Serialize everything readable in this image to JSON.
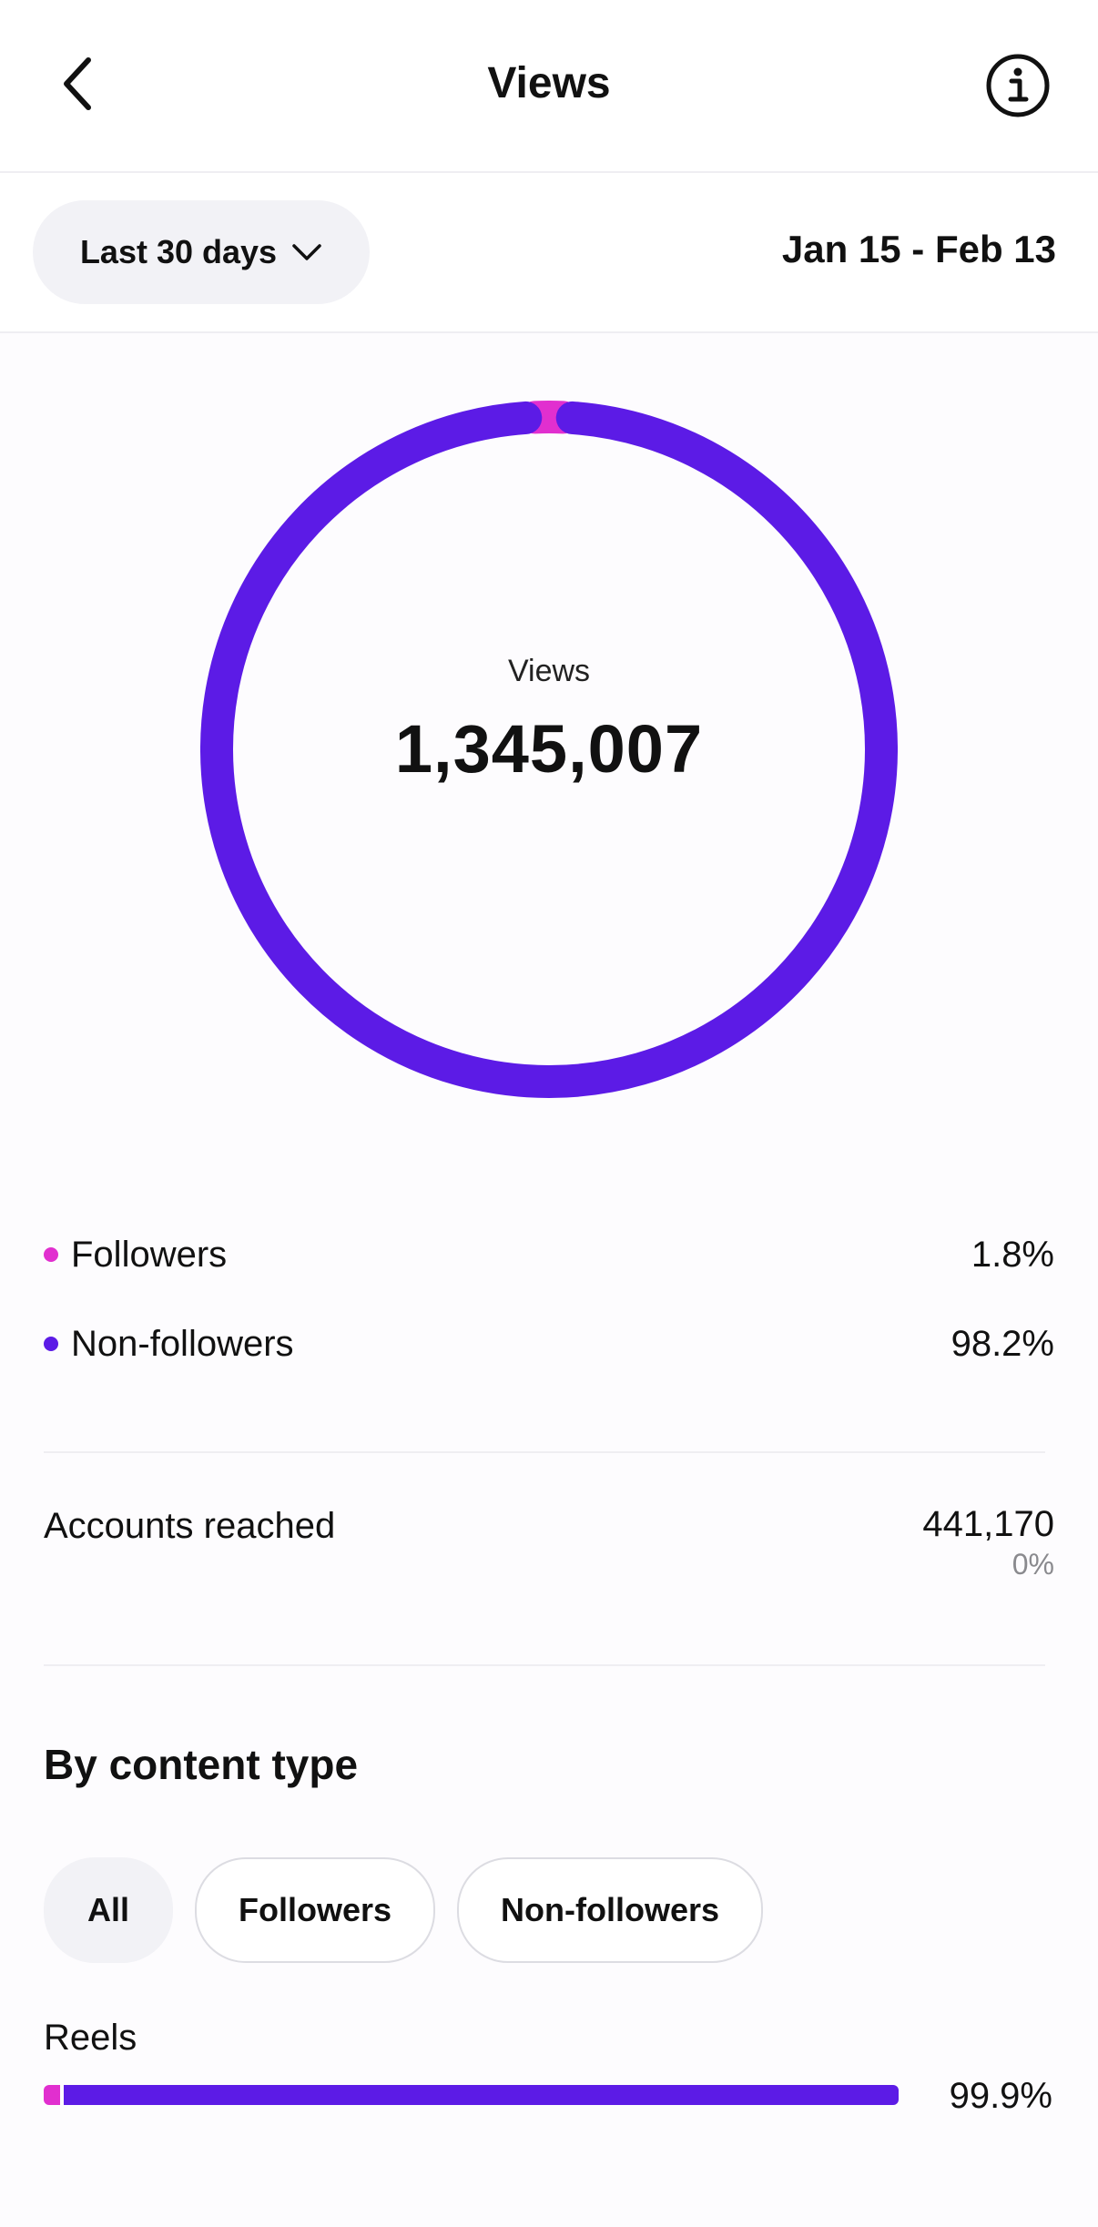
{
  "header": {
    "title": "Views",
    "back_icon": "chevron-left-icon",
    "info_icon": "info-icon"
  },
  "filter": {
    "range_label": "Last 30 days",
    "date_range": "Jan 15 - Feb 13"
  },
  "summary": {
    "label": "Views",
    "value": "1,345,007",
    "colors": {
      "followers": "#e12fcf",
      "non_followers": "#5c1be6"
    }
  },
  "chart_data": {
    "type": "pie",
    "categories": [
      "Followers",
      "Non-followers"
    ],
    "values": [
      1.8,
      98.2
    ]
  },
  "legend": [
    {
      "label": "Followers",
      "value": "1.8%"
    },
    {
      "label": "Non-followers",
      "value": "98.2%"
    }
  ],
  "accounts_reached": {
    "label": "Accounts reached",
    "value": "441,170",
    "change": "0%"
  },
  "content_type": {
    "title": "By content type",
    "chips": [
      "All",
      "Followers",
      "Non-followers"
    ],
    "selected_chip": "All",
    "rows": [
      {
        "label": "Reels",
        "value": "99.9%",
        "followers_share": 0.018,
        "total_share": 0.999
      }
    ]
  }
}
